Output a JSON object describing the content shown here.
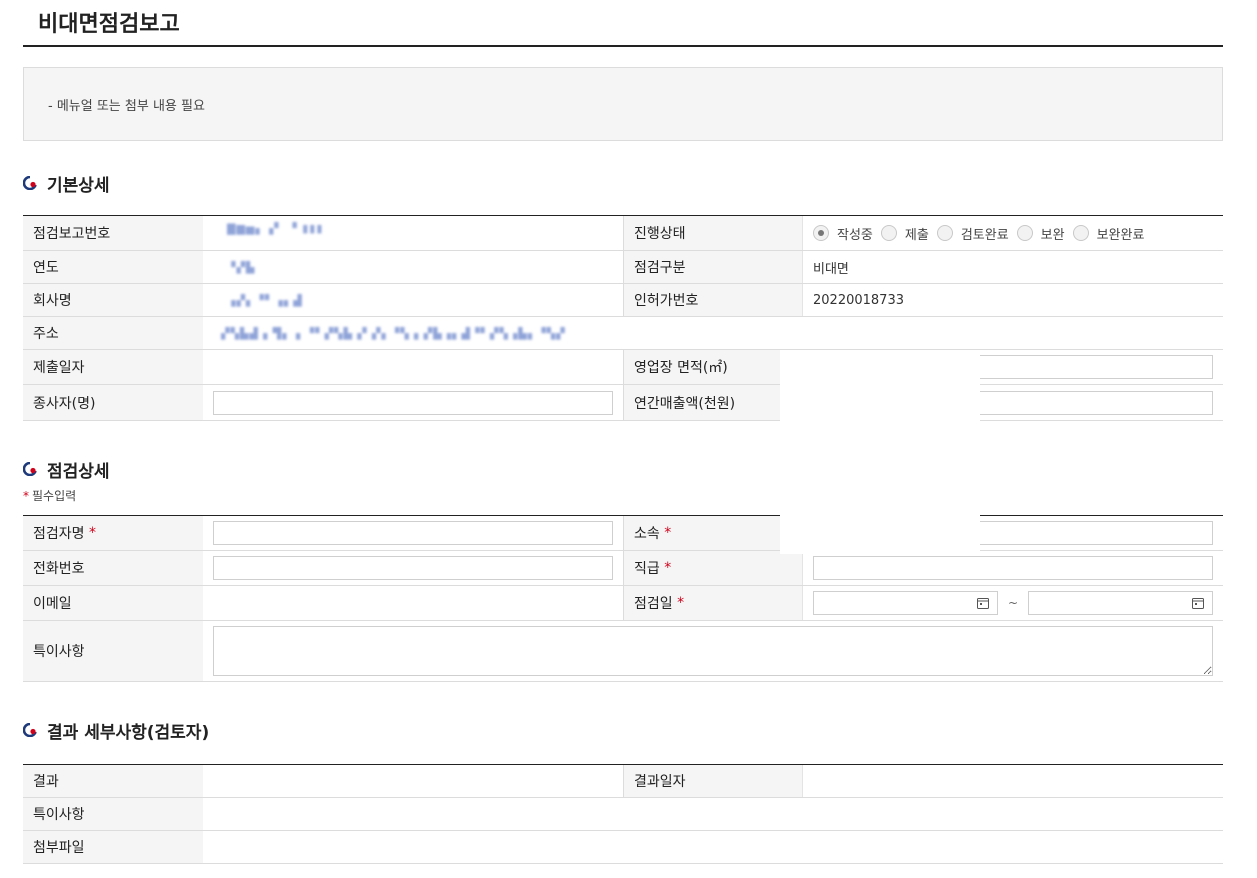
{
  "page": {
    "title": "비대면점검보고",
    "notice": "- 메뉴얼 또는 첨부 내용 필요"
  },
  "sections": {
    "basic": "기본상세",
    "inspect": "점검상세",
    "result": "결과 세부사항(검토자)"
  },
  "required_note": "필수입력",
  "required_mark": "*",
  "basic": {
    "report_no_label": "점검보고번호",
    "status_label": "진행상태",
    "status_options": [
      "작성중",
      "제출",
      "검토완료",
      "보완",
      "보완완료"
    ],
    "status_selected": "작성중",
    "year_label": "연도",
    "inspect_type_label": "점검구분",
    "inspect_type_value": "비대면",
    "company_label": "회사명",
    "license_label": "인허가번호",
    "license_value": "20220018733",
    "address_label": "주소",
    "submit_date_label": "제출일자",
    "area_label": "영업장 면적(㎡)",
    "employees_label": "종사자(명)",
    "sales_label": "연간매출액(천원)"
  },
  "inspect": {
    "inspector_label": "점검자명",
    "dept_label": "소속",
    "phone_label": "전화번호",
    "position_label": "직급",
    "email_label": "이메일",
    "date_label": "점검일",
    "date_sep": "~",
    "remarks_label": "특이사항"
  },
  "result": {
    "result_label": "결과",
    "result_date_label": "결과일자",
    "remarks_label": "특이사항",
    "attach_label": "첨부파일"
  },
  "colors": {
    "accent_red": "#d0021b",
    "accent_navy": "#1f3a7a"
  }
}
